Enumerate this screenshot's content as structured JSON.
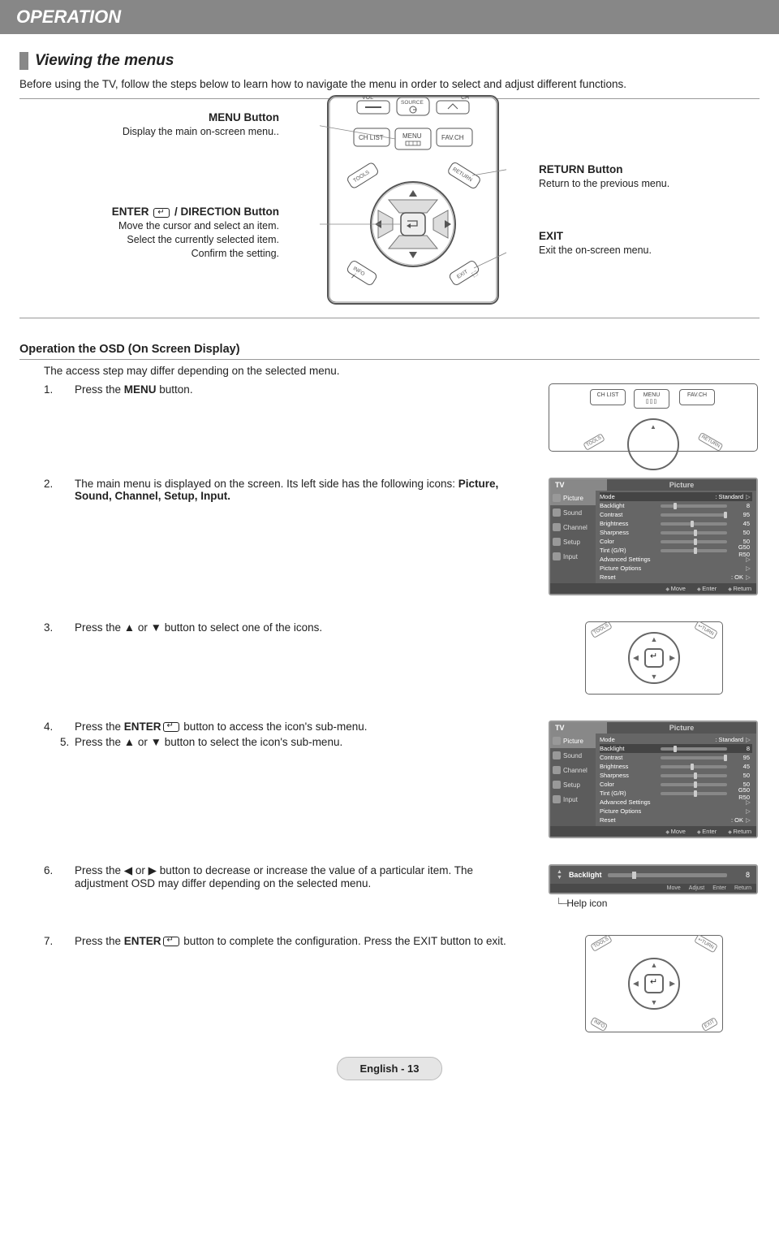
{
  "header": "OPERATION",
  "section_title": "Viewing the menus",
  "intro": "Before using the TV, follow the steps below to learn how to navigate the menu in order to select and adjust different functions.",
  "remote_top": {
    "source": "SOURCE",
    "vol": "VOL",
    "ch": "CH",
    "chlist": "CH LIST",
    "menu": "MENU",
    "favch": "FAV.CH",
    "tools": "TOOLS",
    "return": "RETURN",
    "info": "INFO",
    "exit": "EXIT"
  },
  "callouts": {
    "menu": {
      "title": "MENU Button",
      "desc": "Display the main on-screen menu.."
    },
    "enter": {
      "title_prefix": "ENTER ",
      "title_suffix": " / DIRECTION Button",
      "l1": "Move the cursor and select an item.",
      "l2": "Select the currently selected item.",
      "l3": "Confirm the setting."
    },
    "return": {
      "title": "RETURN Button",
      "desc": "Return to the previous menu."
    },
    "exit": {
      "title": "EXIT",
      "desc": "Exit the on-screen menu."
    }
  },
  "osd_title": "Operation the OSD (On Screen Display)",
  "osd_intro": "The access step may differ depending on the selected menu.",
  "steps": {
    "s1": {
      "num": "1.",
      "t1": "Press the ",
      "bold": "MENU",
      "t2": " button."
    },
    "s2": {
      "num": "2.",
      "t1": "The main menu is displayed on the screen. Its left side has the following icons: ",
      "bold": "Picture, Sound, Channel, Setup, Input.",
      "t2": ""
    },
    "s3": {
      "num": "3.",
      "t": "Press the ▲ or ▼ button to select one of the icons."
    },
    "s4": {
      "num": "4.",
      "t1": "Press the ",
      "bold": "ENTER",
      "t2": " button to access the icon's sub-menu."
    },
    "s5": {
      "num": "5.",
      "t": "Press the ▲ or ▼ button to select the icon's sub-menu."
    },
    "s6": {
      "num": "6.",
      "t": "Press the ◀ or ▶ button to decrease or increase the value of a particular item. The adjustment OSD may differ depending on the selected menu."
    },
    "s7": {
      "num": "7.",
      "t1": "Press the ",
      "bold": "ENTER",
      "t2": " button to complete the configuration. Press the EXIT button to exit."
    }
  },
  "osd_menu": {
    "tv": "TV",
    "section": "Picture",
    "tabs": [
      "Picture",
      "Sound",
      "Channel",
      "Setup",
      "Input"
    ],
    "rows": [
      {
        "lbl": "Mode",
        "val": ": Standard",
        "type": "text"
      },
      {
        "lbl": "Backlight",
        "val": "8",
        "type": "bar",
        "pct": 20
      },
      {
        "lbl": "Contrast",
        "val": "95",
        "type": "bar",
        "pct": 95
      },
      {
        "lbl": "Brightness",
        "val": "45",
        "type": "bar",
        "pct": 45
      },
      {
        "lbl": "Sharpness",
        "val": "50",
        "type": "bar",
        "pct": 50
      },
      {
        "lbl": "Color",
        "val": "50",
        "type": "bar",
        "pct": 50
      },
      {
        "lbl": "Tint (G/R)",
        "val": "G50      R50",
        "type": "bar",
        "pct": 50
      },
      {
        "lbl": "Advanced Settings",
        "val": "",
        "type": "arrow"
      },
      {
        "lbl": "Picture Options",
        "val": "",
        "type": "arrow"
      },
      {
        "lbl": "Reset",
        "val": ": OK",
        "type": "arrow"
      }
    ],
    "foot": [
      "Move",
      "Enter",
      "Return"
    ]
  },
  "adjust": {
    "label": "Backlight",
    "value": "8",
    "foot": [
      "Move",
      "Adjust",
      "Enter",
      "Return"
    ],
    "help": "Help icon"
  },
  "mini_remote": {
    "tools": "TOOLS",
    "return": "RETURN",
    "info": "INFO",
    "exit": "EXIT"
  },
  "mini_row": {
    "chlist": "CH LIST",
    "menu": "MENU",
    "favch": "FAV.CH"
  },
  "page": "English - 13"
}
